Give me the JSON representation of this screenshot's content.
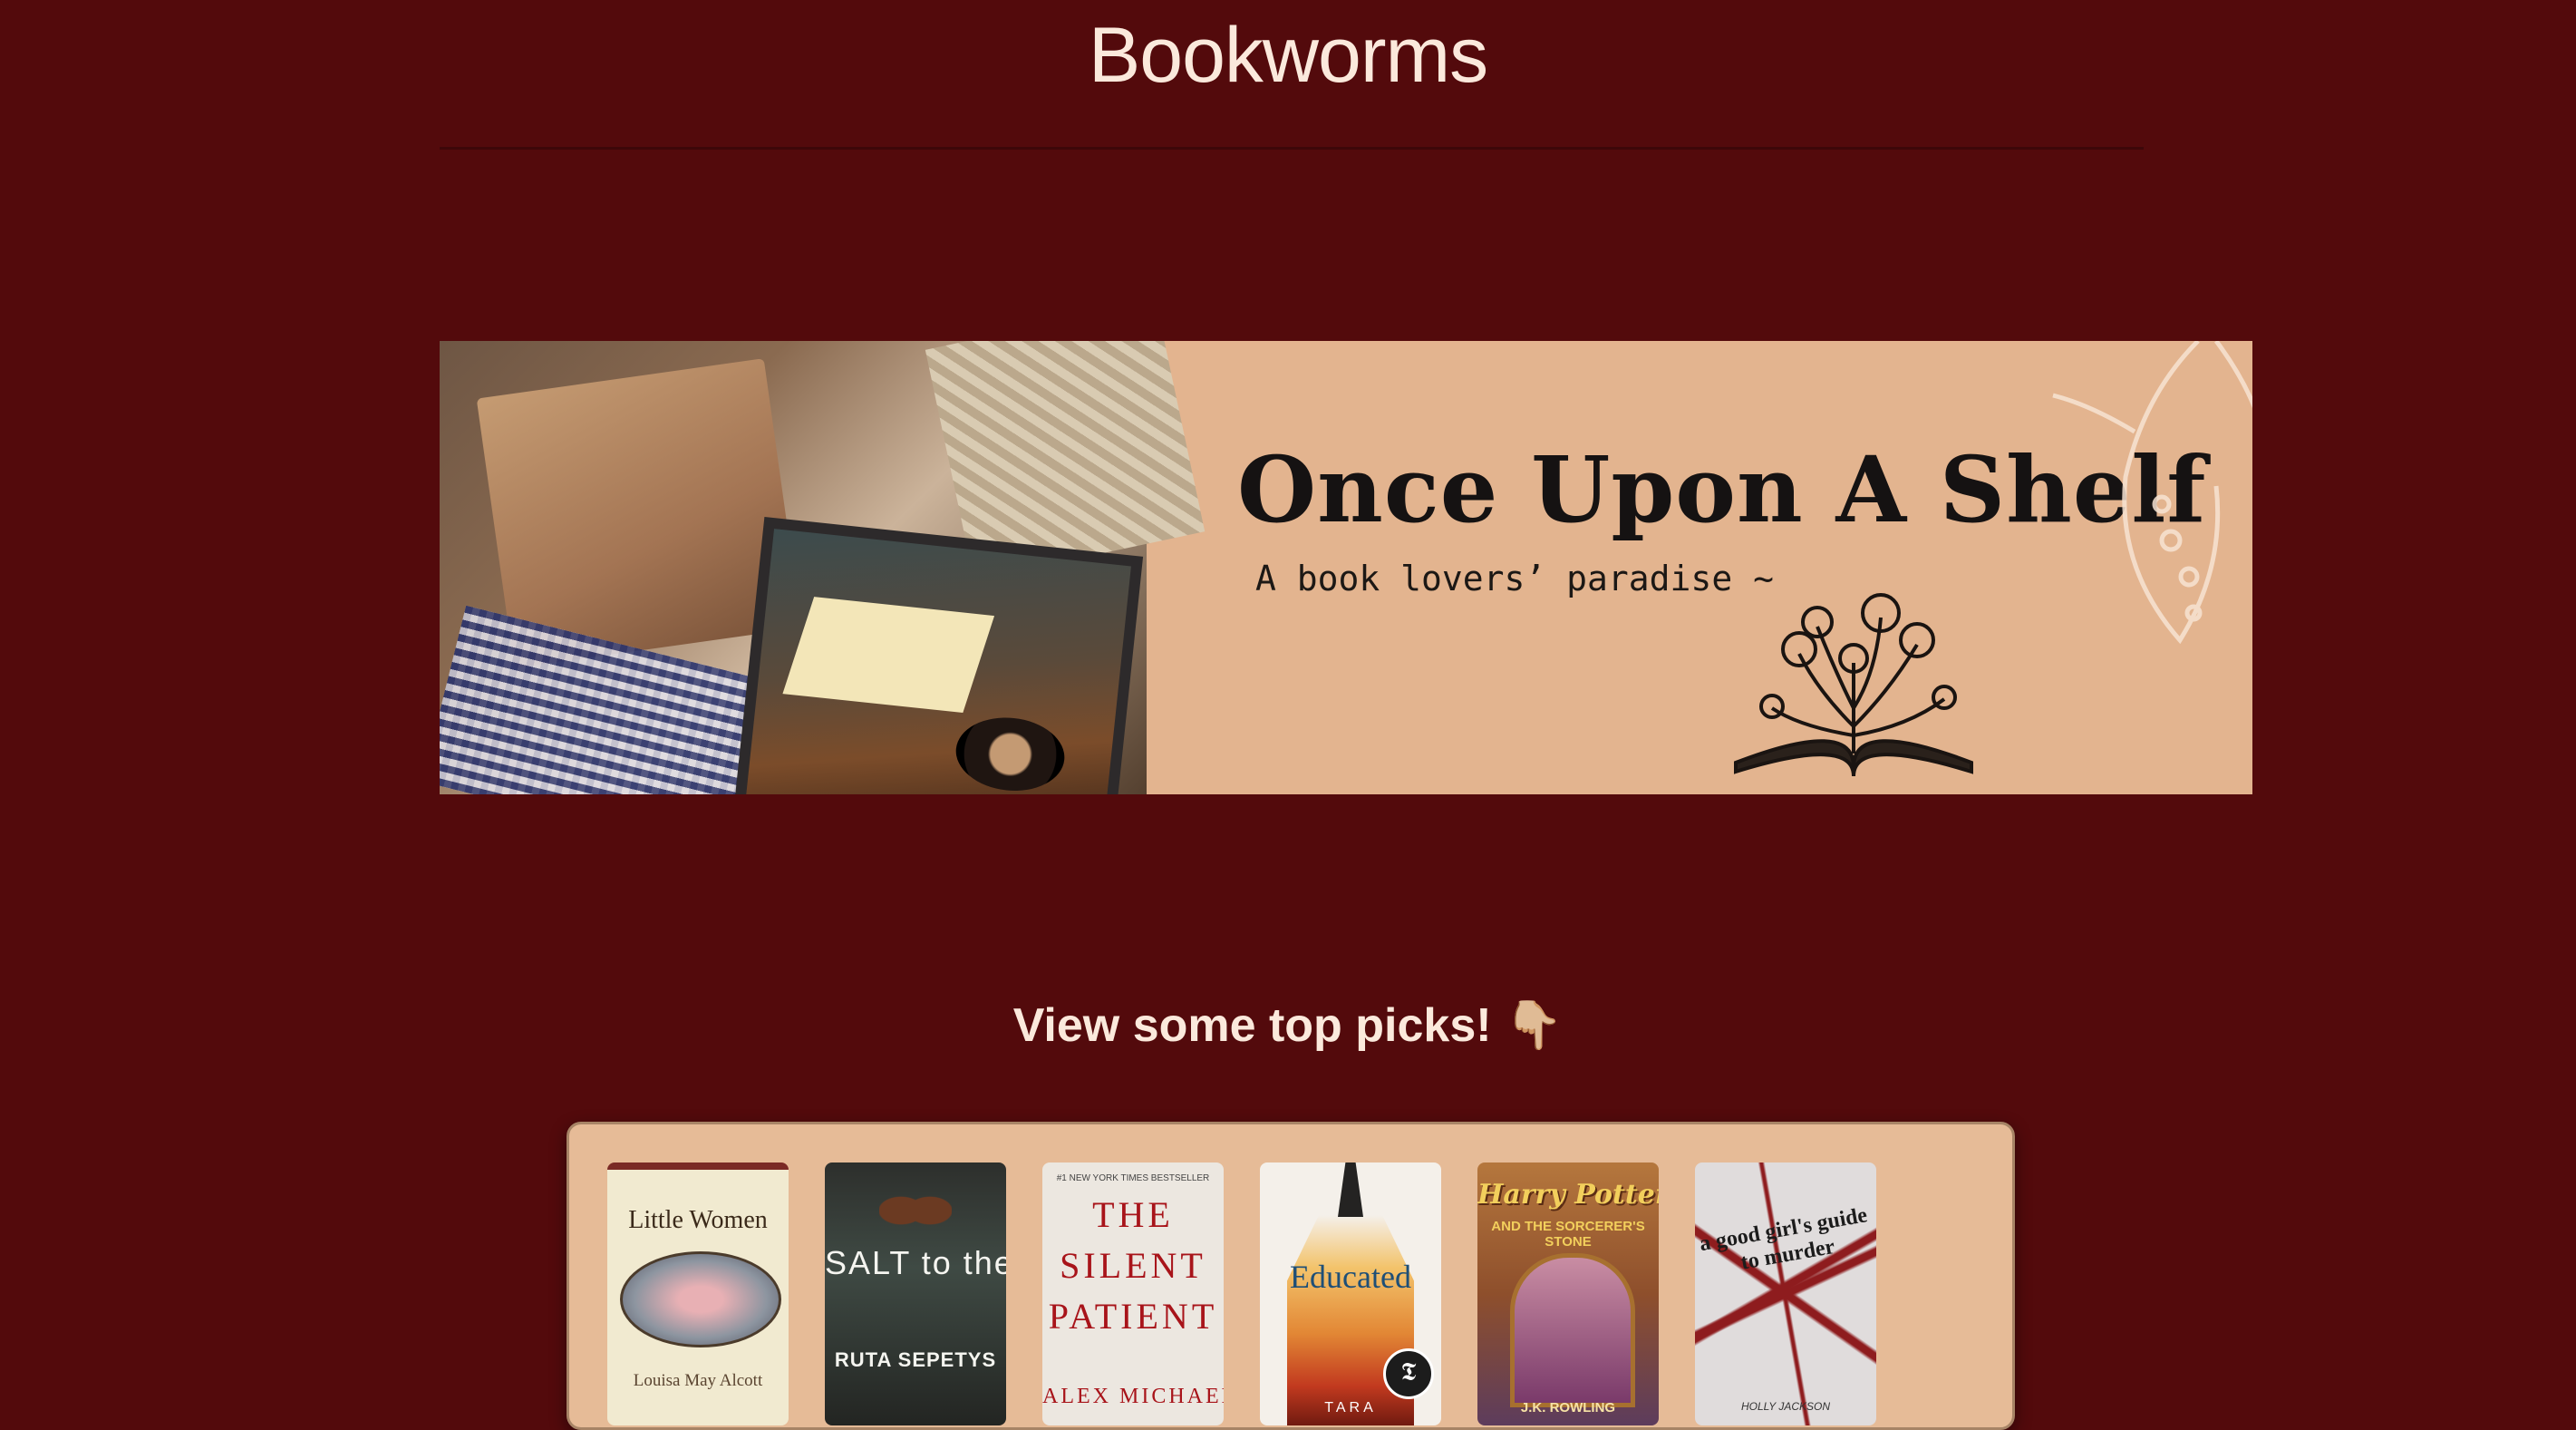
{
  "site": {
    "title": "Bookworms"
  },
  "banner": {
    "heading": "Once Upon A Shelf",
    "tagline": "A book lovers’ paradise ~",
    "photo_icons": [
      "open-book-photo",
      "coffee-cup-photo",
      "air-mail-fabric"
    ]
  },
  "picks": {
    "heading": "View some top picks!",
    "hand_icon": "👇🏼",
    "books": [
      {
        "title": "Little Women",
        "author": "Louisa May Alcott"
      },
      {
        "title": "SALT to the SEA",
        "author": "RUTA SEPETYS"
      },
      {
        "title": "THE SILENT PATIENT",
        "author": "ALEX MICHAELIDES",
        "tagline": "#1 NEW YORK TIMES BESTSELLER"
      },
      {
        "title": "Educated",
        "author": "TARA",
        "seal": "𝕿"
      },
      {
        "title": "Harry Potter",
        "subtitle": "AND THE SORCERER'S STONE",
        "author": "J.K. ROWLING"
      },
      {
        "title": "a good girl's guide to murder",
        "author": "HOLLY JACKSON"
      }
    ]
  },
  "colors": {
    "background": "#530a0c",
    "title_text": "#fbe9dc",
    "panel": "#e6bb97",
    "banner": "#e3b48f"
  }
}
